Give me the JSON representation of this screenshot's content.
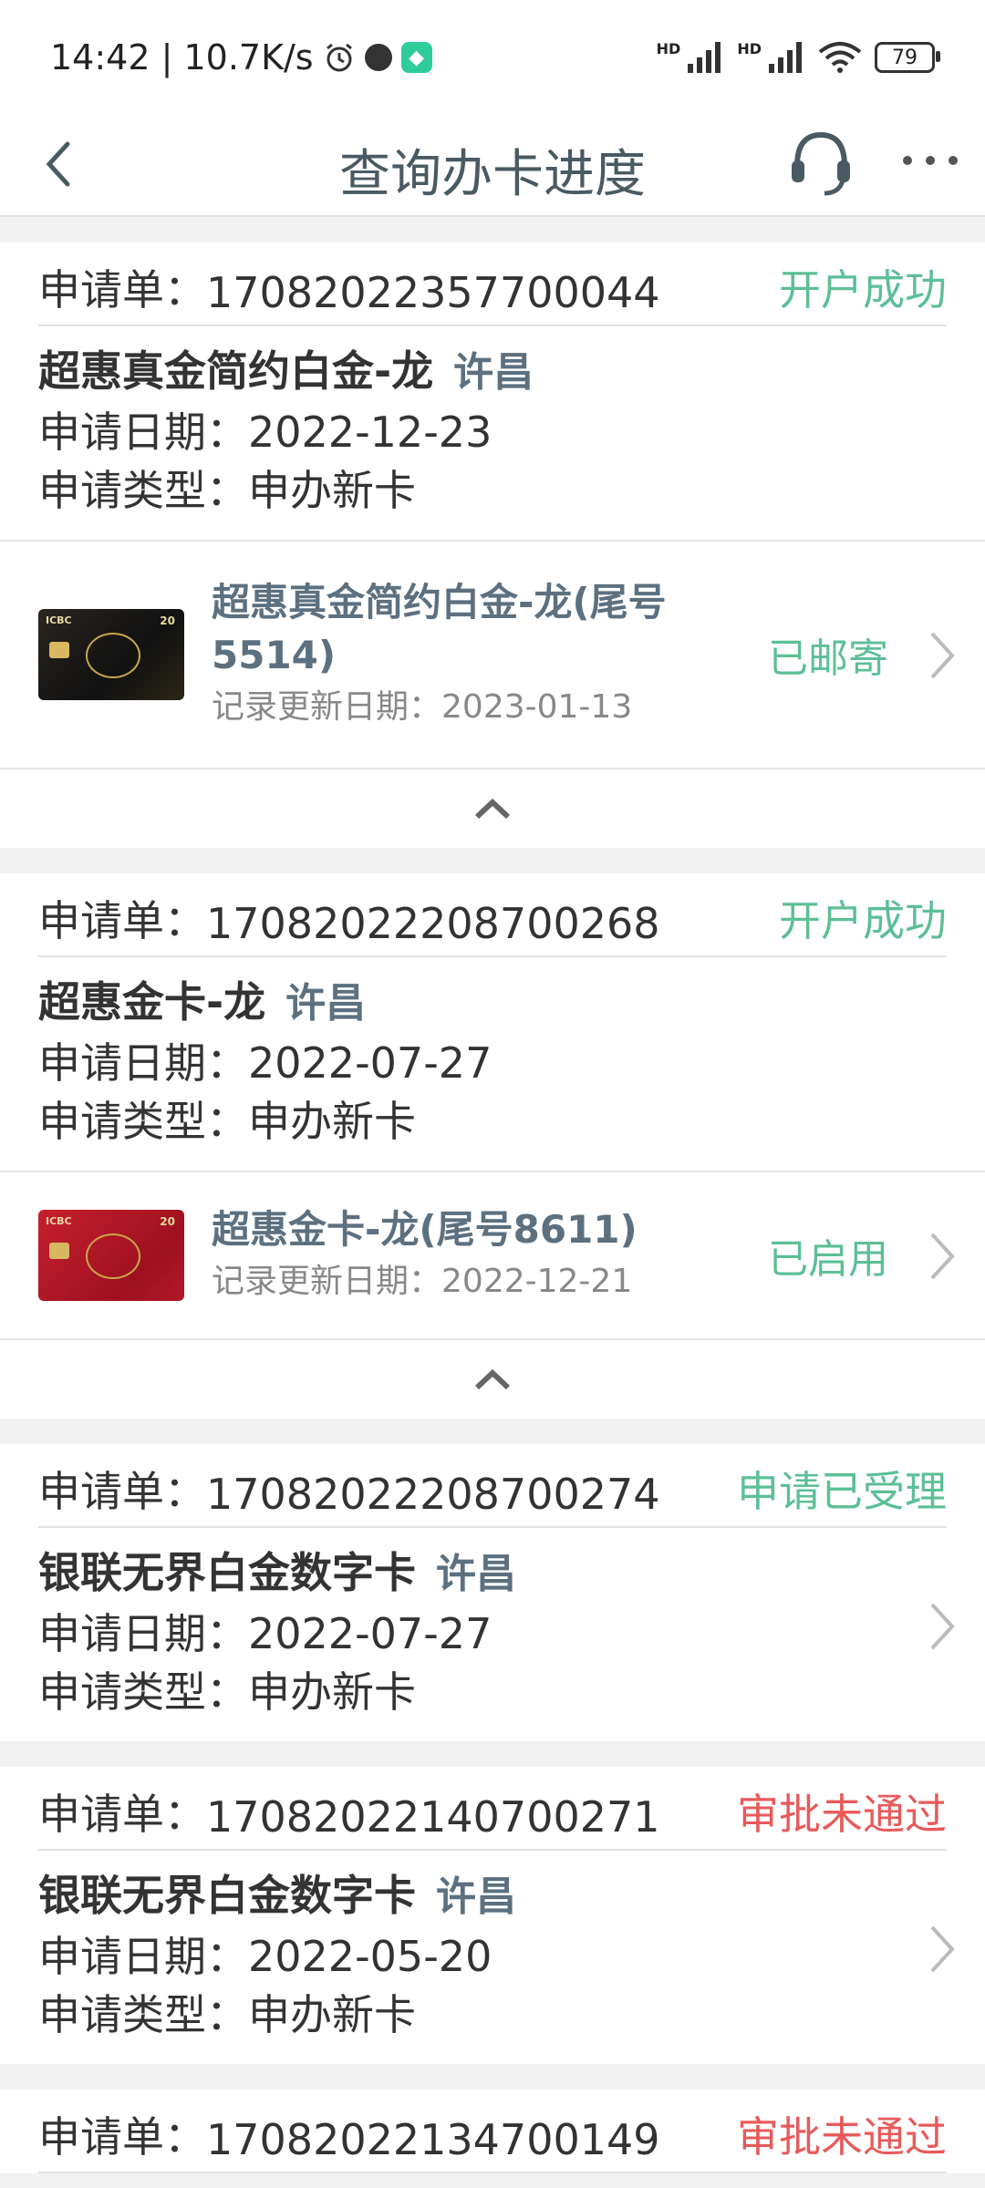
{
  "status_bar": {
    "time_speed": "14:42 | 10.7K/s",
    "signal1_label": "HD",
    "signal2_label": "HD",
    "battery": "79",
    "icons": [
      "alarm-icon",
      "dot-icon",
      "shield-icon",
      "signal-icon",
      "wifi-icon",
      "battery-icon"
    ]
  },
  "nav": {
    "title": "查询办卡进度",
    "icons": [
      "back-icon",
      "support-headset-icon",
      "more-icon"
    ]
  },
  "labels": {
    "order": "申请单：",
    "date": "申请日期：",
    "type": "申请类型：",
    "record_date": "记录更新日期："
  },
  "colors": {
    "success": "#5dbf95",
    "rejected": "#e85a5a",
    "title": "#4a5a63"
  },
  "applications": [
    {
      "order_no": "17082022357700044",
      "status": "开户成功",
      "card_name": "超惠真金简约白金-龙",
      "city": "许昌",
      "date": "2022-12-23",
      "type": "申办新卡",
      "card": {
        "title": "超惠真金简约白金-龙(尾号5514)",
        "record_date": "2023-01-13",
        "status": "已邮寄"
      }
    },
    {
      "order_no": "17082022208700268",
      "status": "开户成功",
      "card_name": "超惠金卡-龙",
      "city": "许昌",
      "date": "2022-07-27",
      "type": "申办新卡",
      "card": {
        "title": "超惠金卡-龙(尾号8611)",
        "record_date": "2022-12-21",
        "status": "已启用"
      }
    },
    {
      "order_no": "17082022208700274",
      "status": "申请已受理",
      "card_name": "银联无界白金数字卡",
      "city": "许昌",
      "date": "2022-07-27",
      "type": "申办新卡"
    },
    {
      "order_no": "17082022140700271",
      "status": "审批未通过",
      "card_name": "银联无界白金数字卡",
      "city": "许昌",
      "date": "2022-05-20",
      "type": "申办新卡"
    },
    {
      "order_no": "17082022134700149",
      "status": "审批未通过"
    }
  ]
}
